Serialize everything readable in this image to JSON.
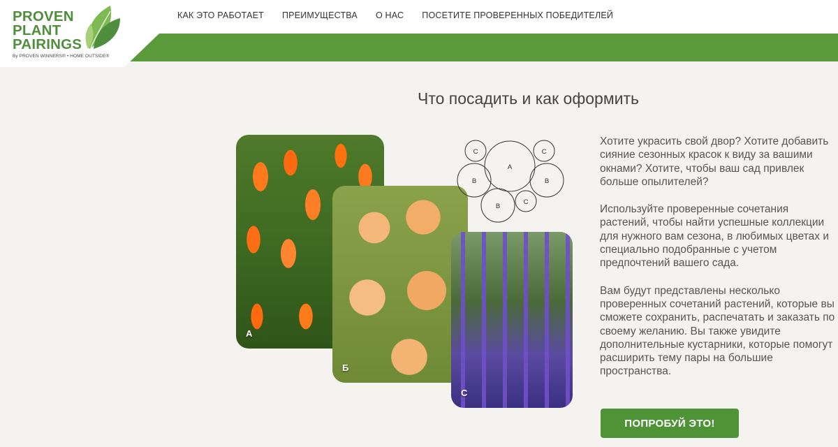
{
  "logo": {
    "lines": [
      "PROVEN",
      "PLANT",
      "PAIRINGS"
    ],
    "byline": "By PROVEN WINNERS® • HOME OUTSIDE®"
  },
  "nav": {
    "items": [
      {
        "label": "КАК ЭТО РАБОТАЕТ"
      },
      {
        "label": "ПРЕИМУЩЕСТВА"
      },
      {
        "label": "О НАС"
      },
      {
        "label": "ПОСЕТИТЕ ПРОВЕРЕННЫХ ПОБЕДИТЕЛЕЙ"
      }
    ]
  },
  "main": {
    "title": "Что посадить и как оформить",
    "photos": [
      {
        "label": "А"
      },
      {
        "label": "Б"
      },
      {
        "label": "С"
      }
    ],
    "diagram": {
      "labels": [
        "A",
        "B",
        "B",
        "B",
        "C",
        "C",
        "C"
      ]
    },
    "paragraphs": [
      "Хотите украсить свой двор? Хотите добавить сияние сезонных красок к виду за вашими окнами? Хотите, чтобы ваш сад привлек больше опылителей?",
      "Используйте проверенные сочетания растений, чтобы найти успешные коллекции для нужного вам сезона, в любимых цветах и специально подобранные с учетом предпочтений вашего сада.",
      "Вам будут представлены несколько проверенных сочетаний растений, которые вы сможете сохранить, распечатать и заказать по своему желанию. Вы также увидите дополнительные кустарники, которые помогут расширить тему пары на большие пространства."
    ],
    "cta_label": "ПОПРОБУЙ ЭТО!"
  },
  "colors": {
    "brand_green": "#5a9a3a",
    "button_green": "#4e9437",
    "background": "#f4f3ef"
  }
}
